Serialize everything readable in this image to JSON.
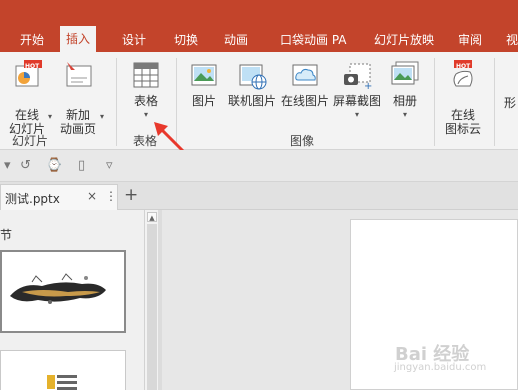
{
  "tabs": [
    "开始",
    "插入",
    "设计",
    "切换",
    "动画",
    "口袋动画 PA",
    "幻灯片放映",
    "审阅",
    "视"
  ],
  "active_tab": "插入",
  "ribbon": {
    "online_slides": "在线\n幻灯片",
    "hot": "HOT",
    "new_anim_page": "新加\n动画页",
    "group_slides": "幻灯片",
    "table": "表格",
    "group_table": "表格",
    "picture": "图片",
    "online_picture_link": "联机图片",
    "online_picture": "在线图片",
    "screenshot": "屏幕截图",
    "album": "相册",
    "group_image": "图像",
    "online_icon": "在线\n图标云",
    "shape_partial": "形"
  },
  "document": {
    "tab_name": "测试.pptx",
    "close_symbol": "×",
    "more_symbol": "⋮",
    "plus_symbol": "+"
  },
  "pane": {
    "section": "节"
  },
  "watermark": {
    "text": "Bai 经验",
    "sub": "jingyan.baidu.com"
  },
  "colors": {
    "accent": "#c3442b",
    "ribbon": "#f3f3f3"
  }
}
